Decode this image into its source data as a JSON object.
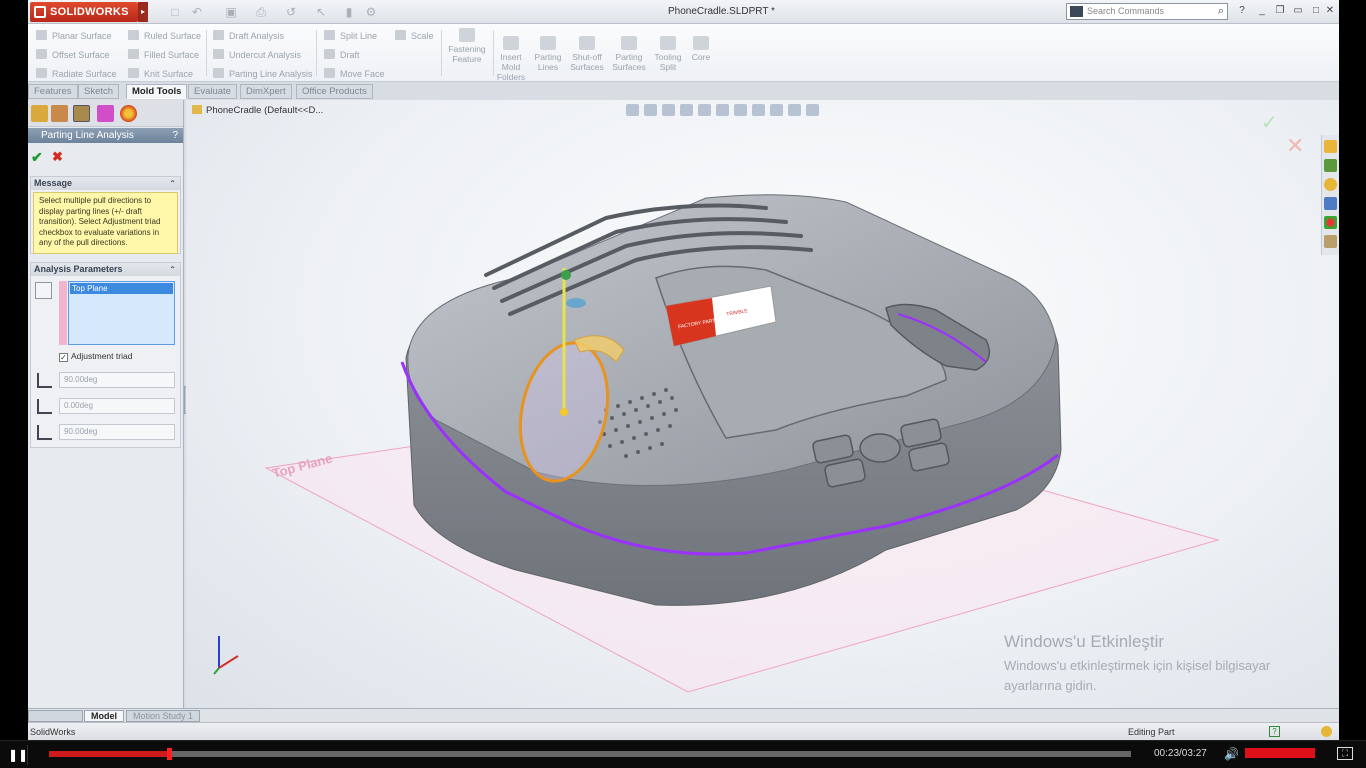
{
  "titlebar": {
    "app_name": "SOLIDWORKS",
    "document_title": "PhoneCradle.SLDPRT *",
    "search_placeholder": "Search Commands"
  },
  "ribbon": {
    "small": [
      {
        "label": "Planar Surface"
      },
      {
        "label": "Offset Surface"
      },
      {
        "label": "Radiate Surface"
      },
      {
        "label": "Ruled Surface"
      },
      {
        "label": "Filled Surface"
      },
      {
        "label": "Knit Surface"
      },
      {
        "label": "Draft Analysis"
      },
      {
        "label": "Undercut Analysis"
      },
      {
        "label": "Parting Line Analysis"
      },
      {
        "label": "Split Line"
      },
      {
        "label": "Draft"
      },
      {
        "label": "Move Face"
      },
      {
        "label": "Scale"
      }
    ],
    "big": [
      {
        "label": "Fastening Feature"
      },
      {
        "label": "Insert Mold Folders"
      },
      {
        "label": "Parting Lines"
      },
      {
        "label": "Shut-off Surfaces"
      },
      {
        "label": "Parting Surfaces"
      },
      {
        "label": "Tooling Split"
      },
      {
        "label": "Core"
      }
    ]
  },
  "tabs": [
    "Features",
    "Sketch",
    "Mold Tools",
    "Evaluate",
    "DimXpert",
    "Office Products"
  ],
  "active_tab": "Mold Tools",
  "property_manager": {
    "title": "Parting Line Analysis",
    "help": "?",
    "message_header": "Message",
    "message": "Select multiple pull directions to display parting lines (+/- draft transition). Select Adjustment triad checkbox to evaluate variations in any of the pull directions.",
    "params_header": "Analysis Parameters",
    "selected_plane": "Top Plane",
    "adjustment_triad_label": "Adjustment triad",
    "adjustment_triad_checked": true,
    "angles": [
      "90.00deg",
      "0.00deg",
      "90.00deg"
    ]
  },
  "viewport": {
    "tree_root": "PhoneCradle  (Default<<D...",
    "plane_label": "Top Plane",
    "logo_text_left": "FACTORY PART",
    "logo_text_right": "TRIMBLE"
  },
  "watermark": {
    "title": "Windows'u Etkinleştir",
    "line": "Windows'u etkinleştirmek için kişisel bilgisayar ayarlarına gidin."
  },
  "sheet_tabs": [
    "Model",
    "Motion Study 1"
  ],
  "status": {
    "app": "SolidWorks",
    "mode": "Editing Part"
  },
  "player": {
    "time": "00:23/03:27",
    "progress": 0.111,
    "volume": 1.0
  },
  "colors": {
    "accent_red": "#cf1b1b",
    "parting_line": "#9b30ff",
    "message_bg": "#fff7a9"
  }
}
